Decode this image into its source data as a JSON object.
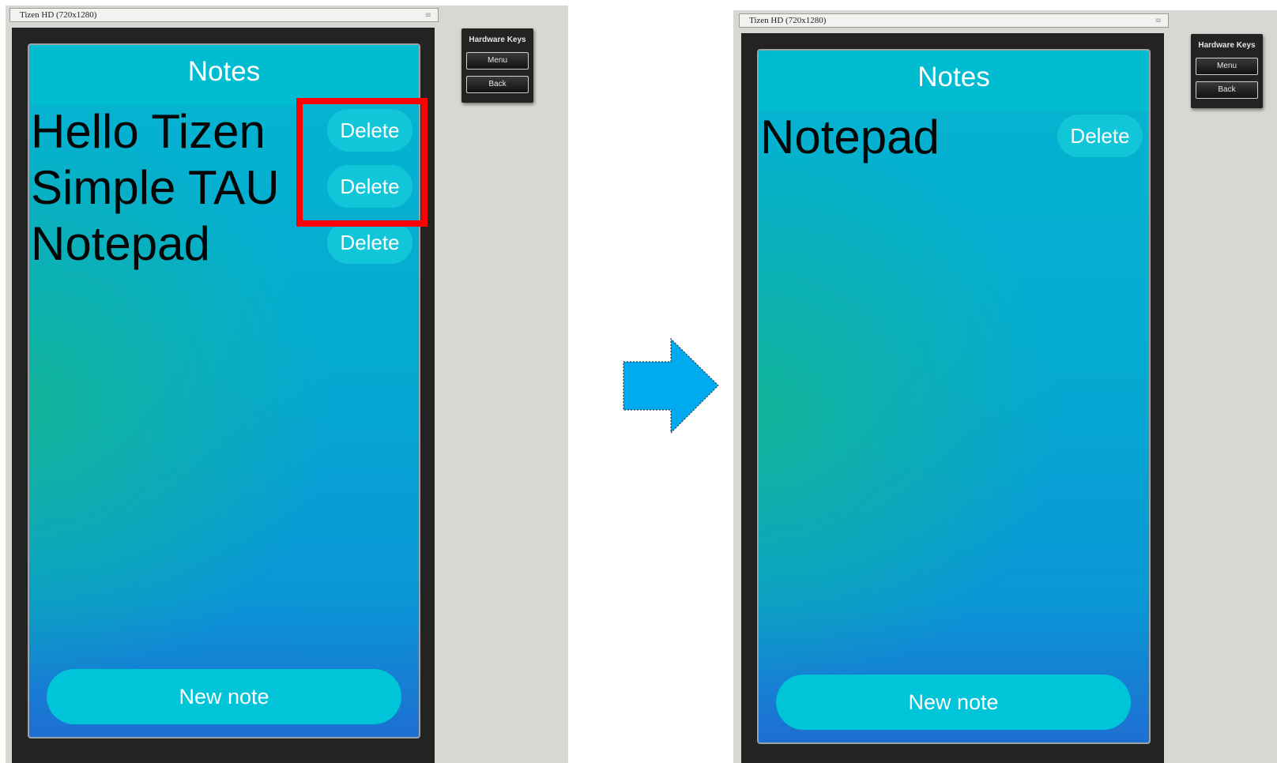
{
  "before": {
    "window_title": "Tizen HD (720x1280)",
    "window_grip": "≡",
    "app_title": "Notes",
    "notes": [
      {
        "text": "Hello Tizen",
        "delete_label": "Delete"
      },
      {
        "text": "Simple TAU",
        "delete_label": "Delete"
      },
      {
        "text": "Notepad",
        "delete_label": "Delete"
      }
    ],
    "new_note_label": "New note",
    "hardware_keys": {
      "title": "Hardware Keys",
      "menu_label": "Menu",
      "back_label": "Back"
    }
  },
  "after": {
    "window_title": "Tizen HD (720x1280)",
    "window_grip": "≡",
    "app_title": "Notes",
    "notes": [
      {
        "text": "Notepad",
        "delete_label": "Delete"
      }
    ],
    "new_note_label": "New note",
    "hardware_keys": {
      "title": "Hardware Keys",
      "menu_label": "Menu",
      "back_label": "Back"
    }
  },
  "colors": {
    "highlight_box": "#ff0000",
    "arrow_fill": "#00aaee",
    "header_bg": "#00bcd0",
    "button_bg": "#00c4d8"
  },
  "icons": {
    "transition_arrow": "arrow-right-icon",
    "window_grip": "grip-icon"
  }
}
